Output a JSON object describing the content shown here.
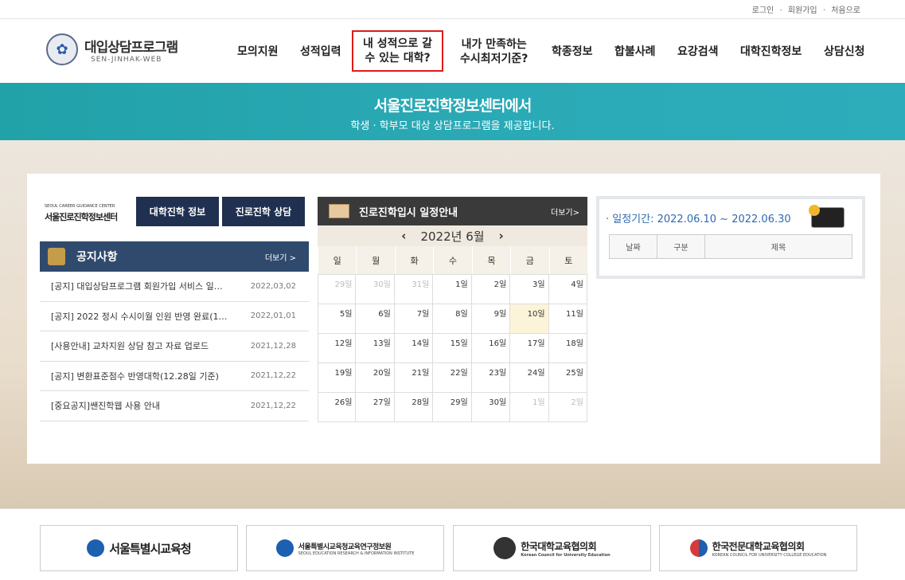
{
  "topbar": {
    "login": "로그인",
    "signup": "회원가입",
    "home": "처음으로",
    "sep": "·"
  },
  "logo": {
    "title": "대입상담프로그램",
    "subtitle": "SEN-JINHAK-WEB"
  },
  "nav": [
    {
      "label": "모의지원"
    },
    {
      "label": "성적입력"
    },
    {
      "label": "내 성적으로 갈\n수 있는 대학?"
    },
    {
      "label": "내가 만족하는\n수시최저기준?"
    },
    {
      "label": "학종정보"
    },
    {
      "label": "합불사례"
    },
    {
      "label": "요강검색"
    },
    {
      "label": "대학진학정보"
    },
    {
      "label": "상담신청"
    }
  ],
  "banner": {
    "title": "서울진로진학정보센터에서",
    "subtitle": "학생 · 학부모 대상 상담프로그램을 제공합니다."
  },
  "brand": {
    "en": "SEOUL CAREER GUIDANCE CENTER",
    "ko": "서울진로진학정보센터"
  },
  "quick": {
    "btn1": "대학진학 정보",
    "btn2": "진로진학 상담"
  },
  "notice": {
    "title": "공지사항",
    "more": "더보기 >",
    "items": [
      {
        "title": "[공지] 대입상담프로그램 회원가입 서비스 일…",
        "date": "2022,03,02"
      },
      {
        "title": "[공지] 2022 정시 수시이월 인원 반영 완료(1…",
        "date": "2022,01,01"
      },
      {
        "title": "[사용안내] 교차지원 상담 참고 자료 업로드",
        "date": "2021,12,28"
      },
      {
        "title": "[공지] 변환표준점수 반영대학(12.28일 기준)",
        "date": "2021,12,22"
      },
      {
        "title": "[중요공지]쌘진학웹 사용 안내",
        "date": "2021,12,22"
      }
    ]
  },
  "calendar": {
    "title": "진로진학입시 일정안내",
    "more": "더보기>",
    "prev": "‹",
    "next": "›",
    "month": "2022년 6월",
    "dows": [
      "일",
      "월",
      "화",
      "수",
      "목",
      "금",
      "토"
    ],
    "weeks": [
      [
        "29일",
        "30일",
        "31일",
        "1일",
        "2일",
        "3일",
        "4일"
      ],
      [
        "5일",
        "6일",
        "7일",
        "8일",
        "9일",
        "10일",
        "11일"
      ],
      [
        "12일",
        "13일",
        "14일",
        "15일",
        "16일",
        "17일",
        "18일"
      ],
      [
        "19일",
        "20일",
        "21일",
        "22일",
        "23일",
        "24일",
        "25일"
      ],
      [
        "26일",
        "27일",
        "28일",
        "29일",
        "30일",
        "1일",
        "2일"
      ]
    ]
  },
  "schedule": {
    "period": "· 일정기간: 2022.06.10 ~ 2022.06.30",
    "cols": [
      "날짜",
      "구분",
      "제목"
    ]
  },
  "footer": [
    {
      "name": "서울특별시교육청",
      "sub": ""
    },
    {
      "name": "서울특별시교육청교육연구정보원",
      "sub": "SEOUL EDUCATION RESEARCH & INFORMATION INSTITUTE"
    },
    {
      "name": "한국대학교육협의회",
      "sub": "Korean Council for University Education"
    },
    {
      "name": "한국전문대학교육협의회",
      "sub": "KOREAN COUNCIL FOR UNIVERSITY COLLEGE EDUCATION"
    }
  ],
  "colors": {
    "banner": "#2aa9b5",
    "navy": "#1f3050",
    "highlight": "#e01b1b",
    "sunday": "#d63a3a",
    "saturday": "#2f5fc8"
  }
}
